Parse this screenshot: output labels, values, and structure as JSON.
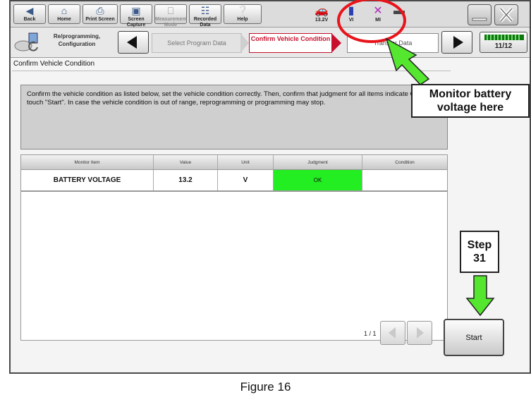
{
  "toolbar": {
    "back": "Back",
    "home": "Home",
    "print_screen": "Print Screen",
    "screen_capture": "Screen Capture",
    "measurement_mode": "Measurement Mode",
    "recorded_data": "Recorded Data",
    "help": "Help"
  },
  "status": {
    "battery_voltage": "13.2V",
    "vi": "VI",
    "mi": "MI"
  },
  "breadcrumb": {
    "title": "Re/programming, Configuration",
    "step1": "Select Program Data",
    "step2": "Confirm Vehicle Condition",
    "step3": "Transfer Data",
    "page_indicator": "11/12"
  },
  "section_title": "Confirm Vehicle Condition",
  "message": "Confirm the vehicle condition as listed below, set the vehicle condition correctly. Then, confirm that judgment for all items indicate OK, and touch \"Start\". In case the vehicle condition is out of range, reprogramming or programming may stop.",
  "table": {
    "headers": [
      "Monitor Item",
      "Value",
      "Unit",
      "Judgment",
      "Condition"
    ],
    "rows": [
      {
        "item": "BATTERY VOLTAGE",
        "value": "13.2",
        "unit": "V",
        "judgment": "OK",
        "condition": ""
      }
    ]
  },
  "pager": "1 / 1",
  "start_button": "Start",
  "annotations": {
    "monitor_callout": "Monitor battery voltage here",
    "step_label": "Step 31",
    "caption": "Figure 16"
  },
  "colors": {
    "ok_green": "#22ee22",
    "annotation_red": "#e8141b",
    "annotation_green": "#55e62f",
    "breadcrumb_active": "#c8102e"
  }
}
